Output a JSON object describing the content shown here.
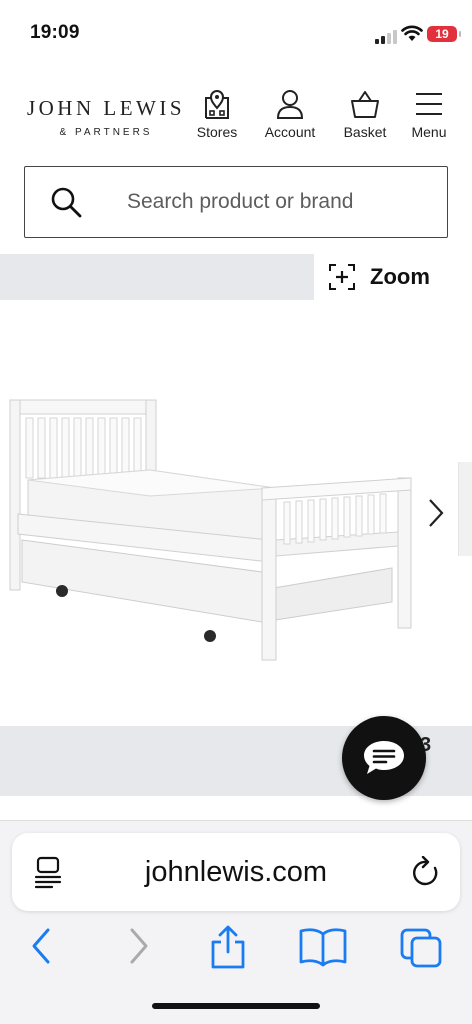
{
  "status_bar": {
    "time": "19:09",
    "battery": "19"
  },
  "header": {
    "brand": {
      "name": "JOHN LEWIS",
      "sub": "& PARTNERS"
    },
    "nav": [
      {
        "label": "Stores",
        "icon": "store-pin-icon"
      },
      {
        "label": "Account",
        "icon": "account-icon"
      },
      {
        "label": "Basket",
        "icon": "basket-icon"
      },
      {
        "label": "Menu",
        "icon": "menu-icon"
      }
    ]
  },
  "search": {
    "placeholder": "Search product or brand",
    "value": ""
  },
  "gallery": {
    "zoom_label": "Zoom",
    "product_image": "white-wooden-guest-bed-with-trundle"
  },
  "chat": {
    "icon": "chat-icon",
    "badge_peek": "3"
  },
  "browser": {
    "url": "johnlewis.com",
    "toolbar": [
      "back-icon",
      "forward-icon",
      "share-icon",
      "bookmarks-icon",
      "tabs-icon"
    ],
    "accent": "#1a7cf2"
  }
}
